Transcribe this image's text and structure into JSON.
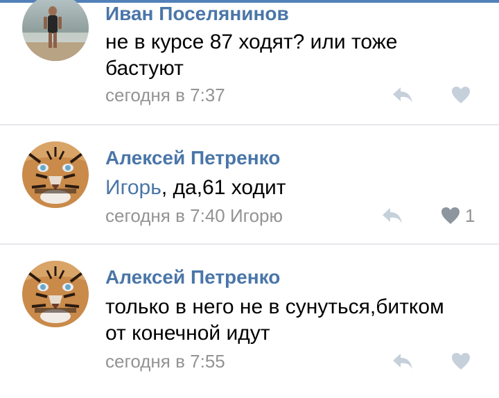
{
  "colors": {
    "accent": "#4a76a8",
    "meta": "#939393",
    "icon": "#c5d0db",
    "liked_icon": "#8d959e"
  },
  "comments": [
    {
      "author": "Иван Поселянинов",
      "mention": "",
      "text": "не в курсе 87 ходят?  или тоже бастуют",
      "time": "сегодня в 7:37",
      "reply_to": "",
      "likes": ""
    },
    {
      "author": "Алексей Петренко",
      "mention": "Игорь",
      "text": ", да,61 ходит",
      "time": "сегодня в 7:40",
      "reply_to": "Игорю",
      "likes": "1"
    },
    {
      "author": "Алексей Петренко",
      "mention": "",
      "text": "только в него не в сунуться,битком от конечной идут",
      "time": "сегодня в 7:55",
      "reply_to": "",
      "likes": ""
    }
  ]
}
